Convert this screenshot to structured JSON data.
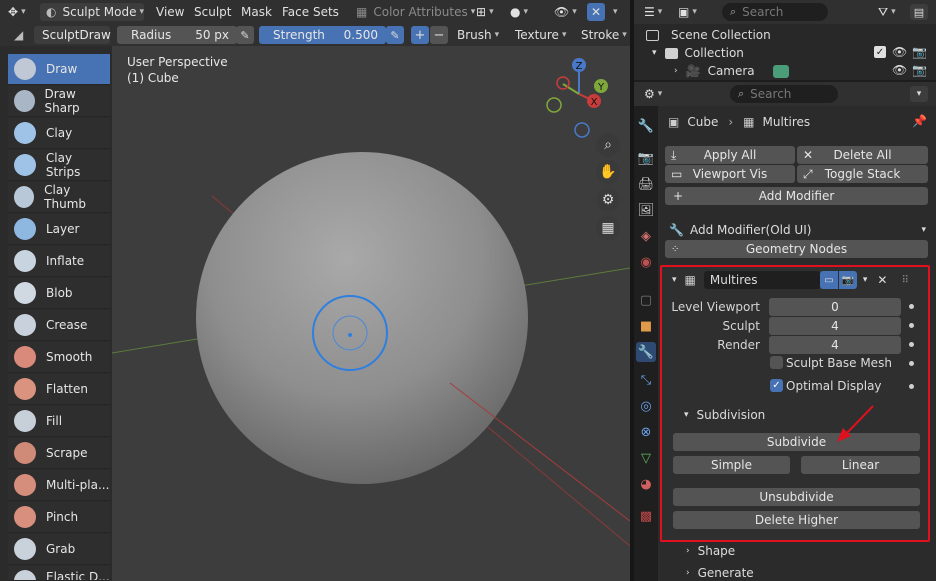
{
  "header": {
    "mode": "Sculpt Mode",
    "menus": [
      "View",
      "Sculpt",
      "Mask",
      "Face Sets"
    ],
    "color_attributes": "Color Attributes"
  },
  "toolbar": {
    "brush_name": "SculptDraw",
    "radius_label": "Radius",
    "radius_value": "50 px",
    "strength_label": "Strength",
    "strength_value": "0.500",
    "brush_menu": "Brush",
    "texture_menu": "Texture",
    "stroke_menu": "Stroke"
  },
  "tools": [
    "Draw",
    "Draw Sharp",
    "Clay",
    "Clay Strips",
    "Clay Thumb",
    "Layer",
    "Inflate",
    "Blob",
    "Crease",
    "Smooth",
    "Flatten",
    "Fill",
    "Scrape",
    "Multi-pla...",
    "Pinch",
    "Grab",
    "Elastic D..."
  ],
  "active_tool": "Draw",
  "viewport": {
    "perspective": "User Perspective",
    "object": "(1) Cube",
    "gizmo": {
      "z": "Z",
      "y": "Y",
      "x": "X"
    }
  },
  "outliner": {
    "search_placeholder": "Search",
    "scene_collection": "Scene Collection",
    "collection": "Collection",
    "camera": "Camera"
  },
  "properties": {
    "search_placeholder": "Search",
    "breadcrumb_object": "Cube",
    "breadcrumb_modifier": "Multires",
    "apply_all": "Apply All",
    "delete_all": "Delete All",
    "viewport_vis": "Viewport Vis",
    "toggle_stack": "Toggle Stack",
    "add_modifier": "Add Modifier",
    "add_modifier_old": "Add Modifier(Old UI)",
    "geometry_nodes": "Geometry Nodes",
    "modifier": {
      "name": "Multires",
      "level_viewport_label": "Level Viewport",
      "level_viewport": "0",
      "sculpt_label": "Sculpt",
      "sculpt": "4",
      "render_label": "Render",
      "render": "4",
      "sculpt_base_mesh": "Sculpt Base Mesh",
      "optimal_display": "Optimal Display",
      "subdivision": "Subdivision",
      "subdivide": "Subdivide",
      "simple": "Simple",
      "linear": "Linear",
      "unsubdivide": "Unsubdivide",
      "delete_higher": "Delete Higher"
    },
    "shape": "Shape",
    "generate": "Generate"
  },
  "colors": {
    "accent": "#4772b3",
    "highlight": "#e0101e"
  }
}
